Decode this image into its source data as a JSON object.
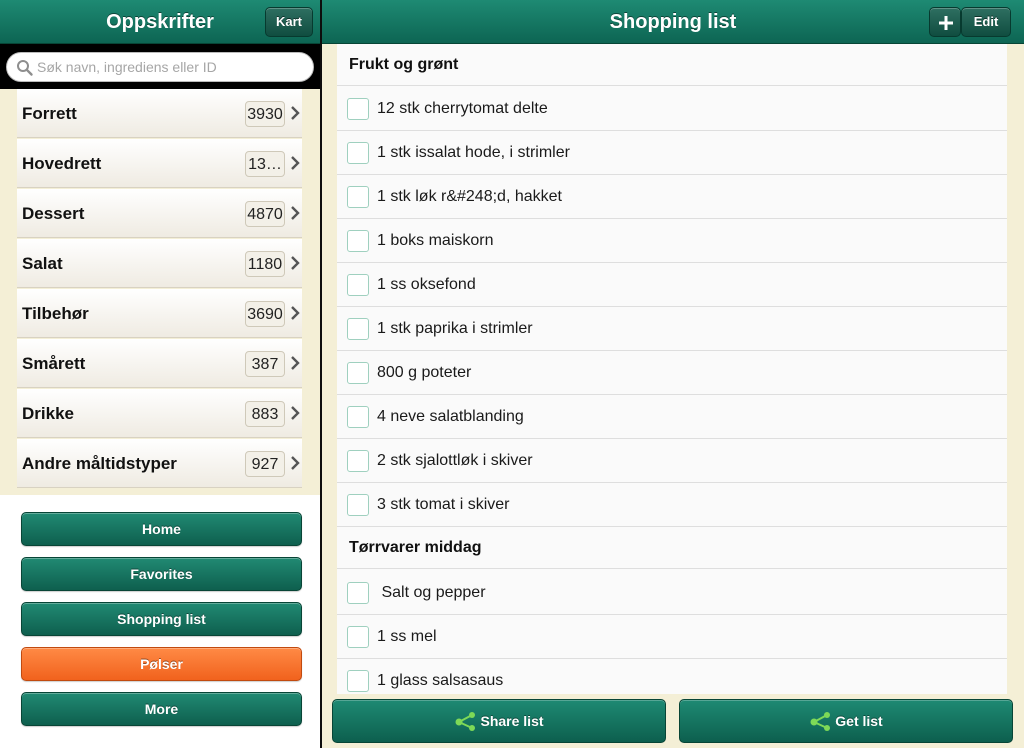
{
  "left_panel": {
    "title": "Oppskrifter",
    "kart_label": "Kart",
    "search": {
      "placeholder": "Søk navn, ingrediens eller ID",
      "value": ""
    },
    "categories": [
      {
        "label": "Forrett",
        "count": "3930"
      },
      {
        "label": "Hovedrett",
        "count": "13…"
      },
      {
        "label": "Dessert",
        "count": "4870"
      },
      {
        "label": "Salat",
        "count": "1180"
      },
      {
        "label": "Tilbehør",
        "count": "3690"
      },
      {
        "label": "Smårett",
        "count": "387"
      },
      {
        "label": "Drikke",
        "count": "883"
      },
      {
        "label": "Andre måltidstyper",
        "count": "927"
      }
    ],
    "menu": [
      {
        "label": "Home"
      },
      {
        "label": "Favorites"
      },
      {
        "label": "Shopping list"
      },
      {
        "label": "Pølser"
      },
      {
        "label": "More"
      }
    ],
    "active_menu": "Pølser"
  },
  "right_panel": {
    "title": "Shopping list",
    "edit_label": "Edit",
    "sections": [
      {
        "title": "Frukt og grønt",
        "items": [
          "12 stk cherrytomat delte",
          "1 stk issalat hode, i strimler",
          "1 stk løk r&#248;d, hakket",
          "1 boks maiskorn",
          "1 ss oksefond",
          "1 stk paprika i strimler",
          "800 g poteter",
          "4 neve salatblanding",
          "2 stk sjalottløk i skiver",
          "3 stk tomat i skiver"
        ]
      },
      {
        "title": "Tørrvarer middag",
        "items": [
          " Salt og pepper",
          "1 ss mel",
          "1 glass salsasaus"
        ]
      }
    ],
    "share_label": "Share list",
    "get_label": "Get list"
  },
  "colors": {
    "header_green": "#0d6553",
    "button_green": "#0e5f4e",
    "active_orange": "#f1621d",
    "list_background": "#f4efd6"
  }
}
